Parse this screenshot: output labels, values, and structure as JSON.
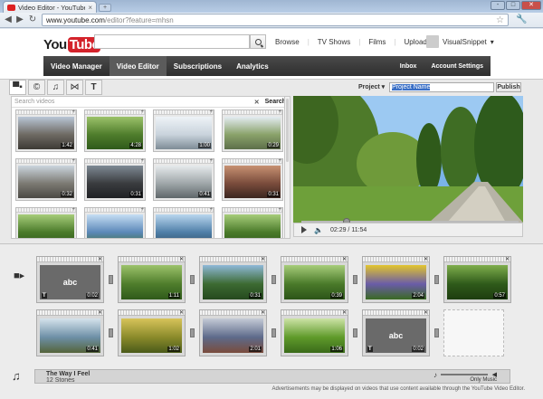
{
  "browser": {
    "tab_title": "Video Editor - YouTube",
    "new_tab": "+",
    "url_host": "www.youtube.com",
    "url_path": "/editor?feature=mhsn",
    "window_buttons": [
      "-",
      "□",
      "✕"
    ]
  },
  "header": {
    "logo_you": "You",
    "logo_tube": "Tube",
    "nav": [
      "Browse",
      "TV Shows",
      "Films",
      "Upload"
    ],
    "username": "VisualSnippet"
  },
  "appbar": {
    "items": [
      "Video Manager",
      "Video Editor",
      "Subscriptions",
      "Analytics"
    ],
    "active": "Video Editor",
    "right_items": [
      "Inbox",
      "Account Settings"
    ]
  },
  "editor": {
    "tool_tabs": [
      "camera-icon",
      "cc-icon",
      "music-icon",
      "transition-icon",
      "text-icon"
    ],
    "project_label": "Project",
    "project_name": "Project Name",
    "publish_label": "Publish",
    "search_placeholder": "Search videos",
    "search_button": "Search",
    "library_clips": [
      {
        "dur": "1:42",
        "scene": "street"
      },
      {
        "dur": "4:28",
        "scene": "park"
      },
      {
        "dur": "1:00",
        "scene": "fountain"
      },
      {
        "dur": "0:29",
        "scene": "fountain2"
      },
      {
        "dur": "0:32",
        "scene": "street2"
      },
      {
        "dur": "0:31",
        "scene": "porch"
      },
      {
        "dur": "0:41",
        "scene": "rocks"
      },
      {
        "dur": "0:31",
        "scene": "people"
      },
      {
        "dur": "",
        "scene": "trees"
      },
      {
        "dur": "",
        "scene": "sky"
      },
      {
        "dur": "",
        "scene": "water"
      },
      {
        "dur": "",
        "scene": "trees"
      }
    ],
    "player_time": "02:29 / 11:54"
  },
  "timeline": {
    "row1": [
      {
        "dur": "0:02",
        "title": "abc",
        "type": "text"
      },
      {
        "dur": "1:11",
        "scene": "park"
      },
      {
        "dur": "0:31",
        "scene": "river"
      },
      {
        "dur": "0:39",
        "scene": "trees"
      },
      {
        "dur": "2:04",
        "scene": "flowers"
      },
      {
        "dur": "0:57",
        "scene": "forest"
      }
    ],
    "row2": [
      {
        "dur": "0:41",
        "scene": "bridge"
      },
      {
        "dur": "1:02",
        "scene": "autumn"
      },
      {
        "dur": "2:01",
        "scene": "river2"
      },
      {
        "dur": "1:06",
        "scene": "meadow"
      },
      {
        "dur": "0:02",
        "title": "abc",
        "type": "text"
      }
    ],
    "audio": {
      "track_title": "The Way I Feel",
      "artist": "12 Stones",
      "mix_label": "Only Music"
    },
    "disclaimer": "Advertisements may be displayed on videos that use content available through the YouTube Video Editor."
  }
}
